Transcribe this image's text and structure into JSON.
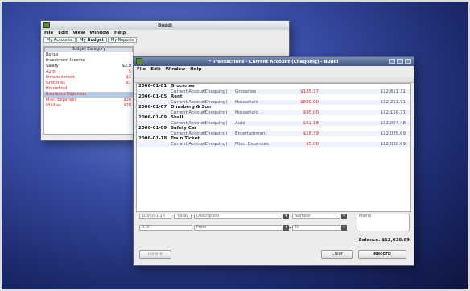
{
  "back_window": {
    "title": "Buddi",
    "menu": [
      "File",
      "Edit",
      "View",
      "Window",
      "Help"
    ],
    "tabs": [
      "My Accounts",
      "My Budget",
      "My Reports"
    ],
    "list_header": "Budget Category",
    "rows": [
      {
        "name": "Bonus",
        "amount": "",
        "red": false
      },
      {
        "name": "Investment Income",
        "amount": "",
        "red": false
      },
      {
        "name": "Salary",
        "amount": "$2,9",
        "red": false
      },
      {
        "name": "Auto",
        "amount": "$",
        "red": true
      },
      {
        "name": "Entertainment",
        "amount": "$1",
        "red": true
      },
      {
        "name": "Groceries",
        "amount": "$1",
        "red": true
      },
      {
        "name": "Household",
        "amount": "",
        "red": true
      },
      {
        "name": "Insurance Expenses",
        "amount": "",
        "red": true,
        "selected": true
      },
      {
        "name": "Misc. Expenses",
        "amount": "$30",
        "red": true
      },
      {
        "name": "Utilities",
        "amount": "$20",
        "red": true
      }
    ]
  },
  "front_window": {
    "title": "* Transactions - Current Account (Chequing) - Buddi",
    "menu": [
      "File",
      "Edit",
      "Window",
      "Help"
    ],
    "transactions": [
      {
        "date": "2006-01-01",
        "description": "Groceries",
        "split": [
          "Current Account",
          "(Chequing)",
          "Groceries",
          "$185.17",
          "$12,811.71"
        ]
      },
      {
        "date": "2006-01-05",
        "description": "Rent",
        "split": [
          "Current Account",
          "(Chequing)",
          "Household",
          "$600.00",
          "$12,211.71"
        ]
      },
      {
        "date": "2006-01-07",
        "description": "Dimsberg & Son",
        "split": [
          "Current Account",
          "(Chequing)",
          "Household",
          "$95.00",
          "$12,116.71"
        ]
      },
      {
        "date": "2006-01-09",
        "description": "Shell",
        "split": [
          "Current Account",
          "(Chequing)",
          "Auto",
          "$62.18",
          "$12,054.48"
        ]
      },
      {
        "date": "2006-01-09",
        "description": "Safety Car",
        "split": [
          "Current Account",
          "(Chequing)",
          "Entertainment",
          "$18.79",
          "$12,035.69"
        ]
      },
      {
        "date": "2006-01-18",
        "description": "Train Ticket",
        "split": [
          "Current Account",
          "(Chequing)",
          "Misc. Expenses",
          "$5.00",
          "$12,030.69"
        ]
      }
    ],
    "entry": {
      "date": "2006/01/18",
      "today_label": "Today",
      "description_placeholder": "Description",
      "number_placeholder": "Number",
      "amount_value": "0.00",
      "from_placeholder": "From",
      "to_placeholder": "To",
      "memo_placeholder": "Memo",
      "balance_label": "Balance:",
      "balance_value": "$12,030.69",
      "delete_label": "Delete",
      "clear_label": "Clear",
      "record_label": "Record"
    }
  }
}
